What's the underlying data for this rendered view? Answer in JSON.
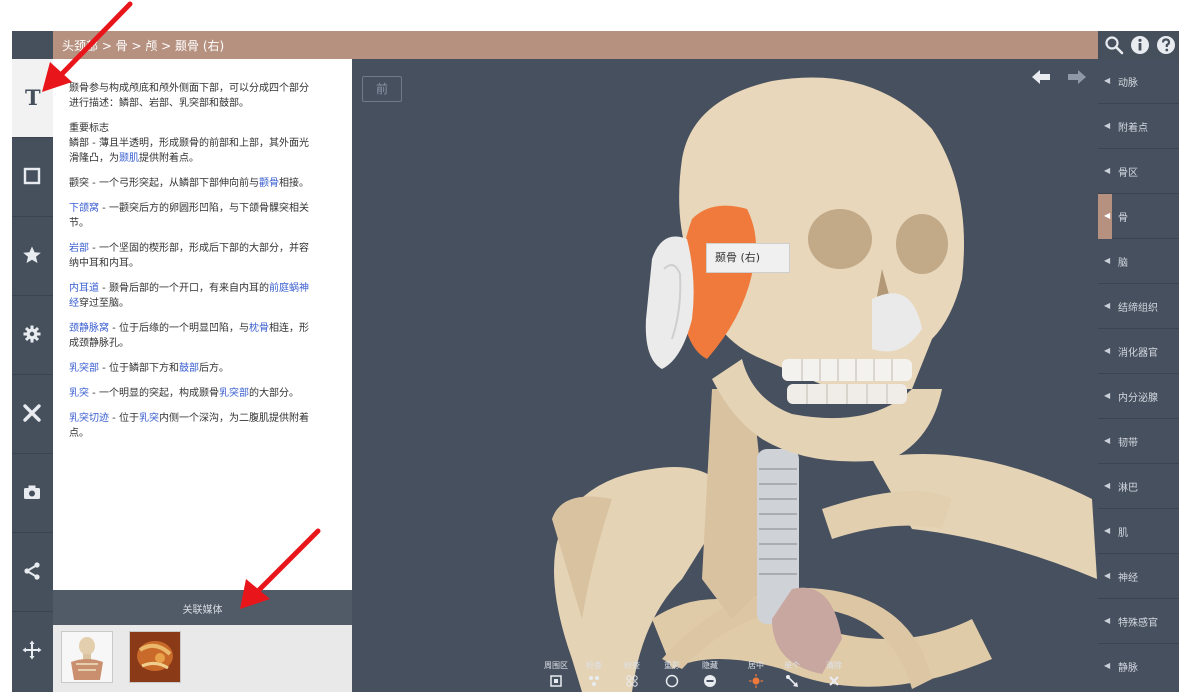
{
  "breadcrumb": "头颈部 > 骨 > 颅 > 颞骨 (右)",
  "top_icons": [
    "search-icon",
    "info-icon",
    "help-icon"
  ],
  "left_rail": [
    {
      "name": "text-tool",
      "glyph": "T",
      "active": true
    },
    {
      "name": "square-tool",
      "icon": "square-icon"
    },
    {
      "name": "favorite-tool",
      "icon": "star-icon"
    },
    {
      "name": "settings-tool",
      "icon": "gear-icon"
    },
    {
      "name": "tools-tool",
      "icon": "wrench-icon"
    },
    {
      "name": "camera-tool",
      "icon": "camera-icon"
    },
    {
      "name": "share-tool",
      "icon": "share-icon"
    },
    {
      "name": "move-tool",
      "icon": "move-icon"
    }
  ],
  "description": {
    "intro": "颞骨参与构成颅底和颅外侧面下部，可以分成四个部分进行描述：鳞部、岩部、乳突部和鼓部。",
    "landmarks_title": "重要标志",
    "p1_a": "鳞部 - 薄且半透明，形成颞骨的前部和上部，其外面光滑隆凸，为",
    "p1_link": "颞肌",
    "p1_b": "提供附着点。",
    "p2_a": "颧突 - 一个弓形突起，从鳞部下部伸向前与",
    "p2_link": "颧骨",
    "p2_b": "相接。",
    "p3_link": "下颌窝",
    "p3_b": " - 一颧突后方的卵圆形凹陷，与下颌骨髁突相关节。",
    "p4_link": "岩部",
    "p4_b": " - 一个坚固的楔形部，形成后下部的大部分，并容纳中耳和内耳。",
    "p5_link": "内耳道",
    "p5_b": " - 颞骨后部的一个开口，有来自内耳的",
    "p5_link2": "前庭蜗神经",
    "p5_c": "穿过至脑。",
    "p6_link": "颈静脉窝",
    "p6_b": " - 位于后缘的一个明显凹陷，与",
    "p6_link2": "枕骨",
    "p6_c": "相连，形成颈静脉孔。",
    "p7_link": "乳突部",
    "p7_b": " - 位于鳞部下方和",
    "p7_link2": "鼓部",
    "p7_c": "后方。",
    "p8_link": "乳突",
    "p8_b": " - 一个明显的突起，构成颞骨",
    "p8_link2": "乳突部",
    "p8_c": "的大部分。",
    "p9_link": "乳突切迹",
    "p9_b": " - 位于",
    "p9_link2": "乳突",
    "p9_c": "内侧一个深沟，为二腹肌提供附着点。"
  },
  "related_media_label": "关联媒体",
  "viewport": {
    "view_label": "前",
    "tooltip": "颞骨 (右)",
    "nav_icons": [
      "back-arrow-icon",
      "forward-arrow-icon"
    ],
    "toolbar": [
      {
        "label": "周围区",
        "icon": "surround-icon"
      },
      {
        "label": "检查",
        "icon": "inspect-icon"
      },
      {
        "label": "检查",
        "icon": "inspect-multi-icon"
      },
      {
        "label": "重影",
        "icon": "ghost-icon"
      },
      {
        "label": "隐藏",
        "icon": "hide-icon"
      },
      {
        "label": "居中",
        "icon": "center-icon"
      },
      {
        "label": "单个",
        "icon": "single-icon"
      },
      {
        "label": "清除",
        "icon": "clear-icon"
      }
    ]
  },
  "right_menu": [
    {
      "label": "动脉"
    },
    {
      "label": "附着点"
    },
    {
      "label": "骨区"
    },
    {
      "label": "骨",
      "active": true
    },
    {
      "label": "脑"
    },
    {
      "label": "结缔组织"
    },
    {
      "label": "消化器官"
    },
    {
      "label": "内分泌腺"
    },
    {
      "label": "韧带"
    },
    {
      "label": "淋巴"
    },
    {
      "label": "肌"
    },
    {
      "label": "神经"
    },
    {
      "label": "特殊感官"
    },
    {
      "label": "静脉"
    }
  ],
  "colors": {
    "breadcrumb_bg": "#b69180",
    "panel_dark": "#47505e",
    "link_blue": "#3a5fd0",
    "highlight_bone": "#f07a3c",
    "bone": "#e5d3b5",
    "annotation_red": "#e8161b"
  }
}
